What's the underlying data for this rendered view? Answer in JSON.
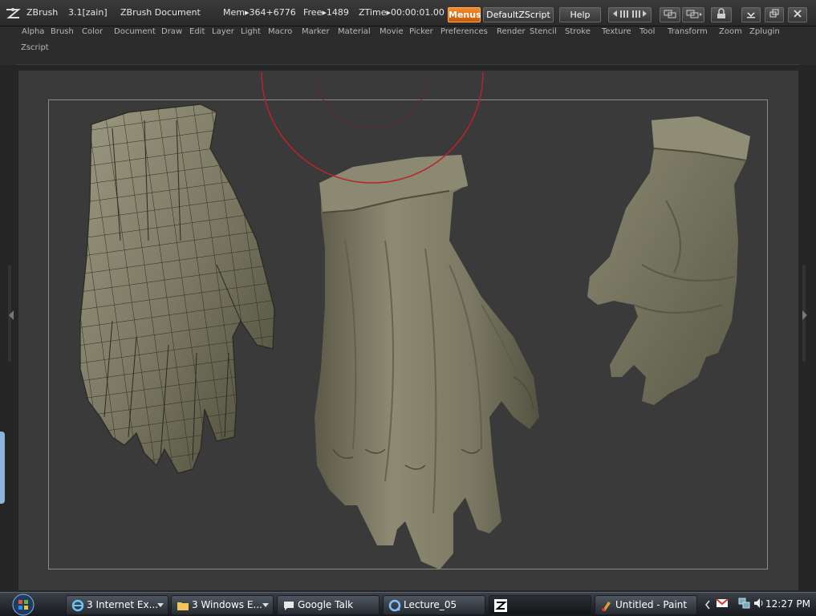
{
  "titlebar": {
    "app_name": "ZBrush",
    "version": "3.1[zain]",
    "document": "ZBrush Document",
    "mem": "Mem▸364+6776",
    "free": "Free▸1489",
    "ztime": "ZTime▸00:00:01.00",
    "menus_label": "Menus",
    "script_label": "DefaultZScript",
    "help_label": "Help"
  },
  "menubar": {
    "items": [
      "Alpha",
      "Brush",
      "Color",
      "Document",
      "Draw",
      "Edit",
      "Layer",
      "Light",
      "Macro",
      "Marker",
      "Material",
      "Movie",
      "Picker",
      "Preferences",
      "Render",
      "Stencil",
      "Stroke",
      "Texture",
      "Tool",
      "Transform",
      "Zoom",
      "Zplugin",
      "Zscript"
    ]
  },
  "taskbar": {
    "tasks": [
      {
        "label": "3 Internet Ex...",
        "icon": "ie-icon"
      },
      {
        "label": "3 Windows E...",
        "icon": "folder-icon"
      },
      {
        "label": "Google Talk",
        "icon": "chat-icon"
      },
      {
        "label": "Lecture_05",
        "icon": "quicktime-icon"
      },
      {
        "label": "",
        "icon": "zbrush-icon"
      },
      {
        "label": "Untitled - Paint",
        "icon": "paint-icon"
      }
    ],
    "clock": "12:27 PM"
  },
  "colors": {
    "menus_accent": "#e8771b",
    "brush_cursor": "#c8282a",
    "canvas_bg": "#3a3a3a",
    "model_material": "#7e7c66"
  }
}
